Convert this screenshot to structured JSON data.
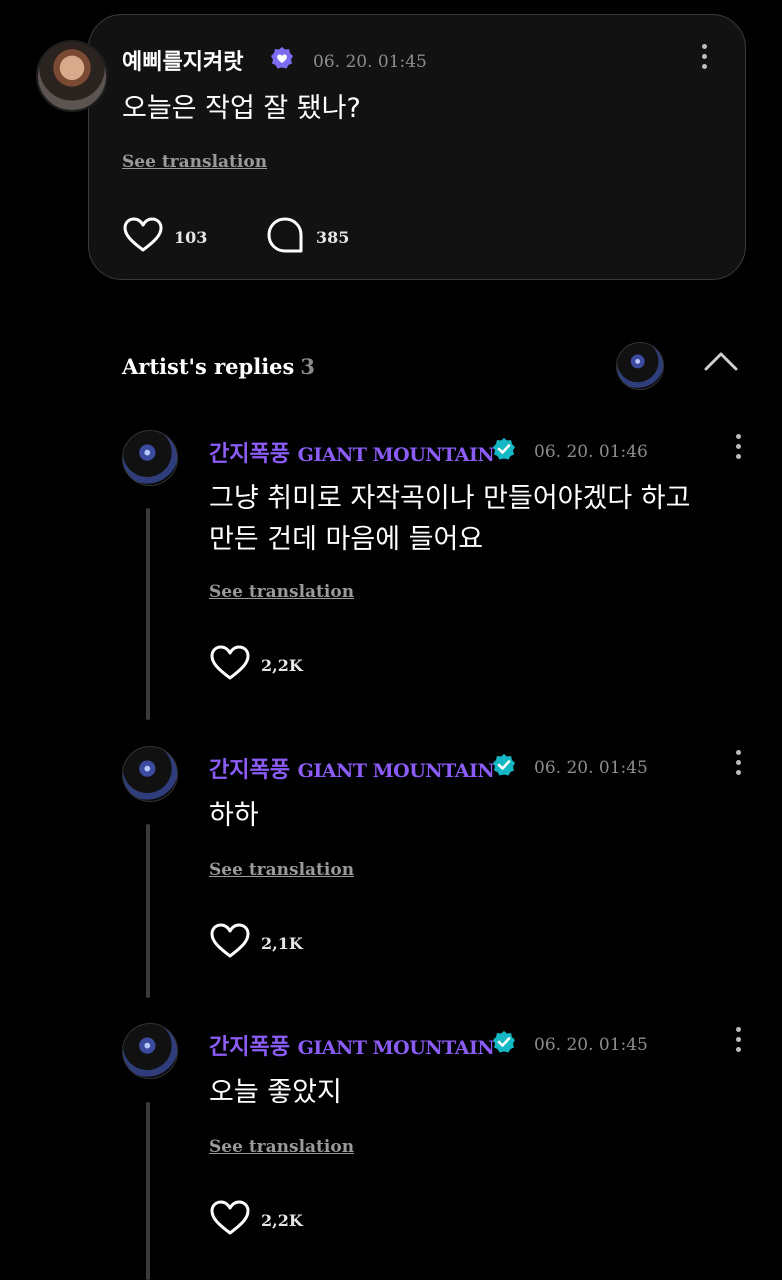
{
  "post": {
    "author": "예삐를지켜랏",
    "timestamp": "06. 20. 01:45",
    "text": "오늘은 작업 잘 됐나?",
    "see_translation": "See translation",
    "likes": "103",
    "comments": "385"
  },
  "replies_section": {
    "title": "Artist's replies",
    "count": "3"
  },
  "replies": [
    {
      "name_kr": "간지폭풍",
      "name_en": "GIANT MOUNTAIN",
      "timestamp": "06. 20. 01:46",
      "text_line1": "그냥 취미로 자작곡이나 만들어야겠다 하고",
      "text_line2": "만든 건데 마음에 들어요",
      "see_translation": "See translation",
      "likes": "2,2K"
    },
    {
      "name_kr": "간지폭풍",
      "name_en": "GIANT MOUNTAIN",
      "timestamp": "06. 20. 01:45",
      "text_line1": "하하",
      "see_translation": "See translation",
      "likes": "2,1K"
    },
    {
      "name_kr": "간지폭풍",
      "name_en": "GIANT MOUNTAIN",
      "timestamp": "06. 20. 01:45",
      "text_line1": "오늘 좋았지",
      "see_translation": "See translation",
      "likes": "2,2K"
    }
  ],
  "icons": {
    "fan_badge": "fan-verified-heart-icon",
    "artist_badge": "artist-verified-check-icon",
    "like": "heart-icon",
    "comment": "comment-bubble-icon",
    "more": "more-vertical-icon",
    "collapse": "chevron-up-icon"
  },
  "colors": {
    "background": "#000000",
    "card": "#121212",
    "artist_name": "#8b5cf6",
    "artist_badge": "#14b8c4",
    "fan_badge": "#7c6cf0"
  }
}
